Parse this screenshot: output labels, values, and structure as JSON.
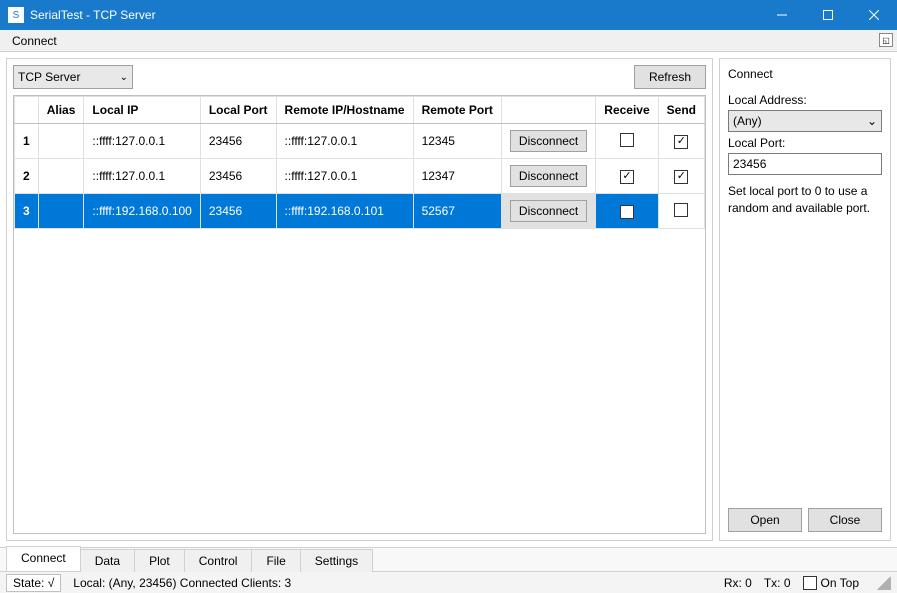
{
  "window": {
    "title": "SerialTest - TCP Server"
  },
  "menubar": {
    "connect": "Connect"
  },
  "toolbar": {
    "protocol_selected": "TCP Server",
    "refresh": "Refresh"
  },
  "table": {
    "headers": {
      "alias": "Alias",
      "local_ip": "Local IP",
      "local_port": "Local Port",
      "remote_host": "Remote IP/Hostname",
      "remote_port": "Remote Port",
      "action": "",
      "receive": "Receive",
      "send": "Send"
    },
    "rows": [
      {
        "n": "1",
        "alias": "",
        "local_ip": "::ffff:127.0.0.1",
        "local_port": "23456",
        "remote_host": "::ffff:127.0.0.1",
        "remote_port": "12345",
        "action": "Disconnect",
        "receive": false,
        "send": true,
        "selected": false
      },
      {
        "n": "2",
        "alias": "",
        "local_ip": "::ffff:127.0.0.1",
        "local_port": "23456",
        "remote_host": "::ffff:127.0.0.1",
        "remote_port": "12347",
        "action": "Disconnect",
        "receive": true,
        "send": true,
        "selected": false
      },
      {
        "n": "3",
        "alias": "",
        "local_ip": "::ffff:192.168.0.100",
        "local_port": "23456",
        "remote_host": "::ffff:192.168.0.101",
        "remote_port": "52567",
        "action": "Disconnect",
        "receive": true,
        "send": false,
        "selected": true
      }
    ]
  },
  "side": {
    "title": "Connect",
    "local_address_label": "Local Address:",
    "local_address_value": "(Any)",
    "local_port_label": "Local Port:",
    "local_port_value": "23456",
    "hint": "Set local port to 0 to use a random and available port.",
    "open": "Open",
    "close": "Close"
  },
  "tabs": {
    "items": [
      "Connect",
      "Data",
      "Plot",
      "Control",
      "File",
      "Settings"
    ],
    "active": 0
  },
  "status": {
    "state_label": "State: √",
    "local_info": "Local: (Any, 23456) Connected Clients: 3",
    "rx": "Rx: 0",
    "tx": "Tx: 0",
    "ontop": "On Top"
  }
}
